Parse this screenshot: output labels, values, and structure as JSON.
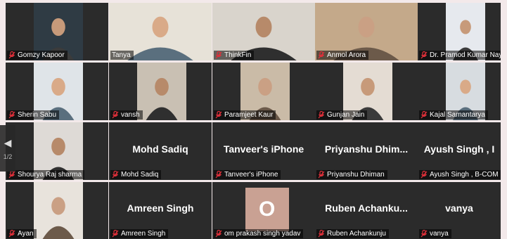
{
  "participants": [
    {
      "name": "Gomzy Kapoor",
      "muted": true,
      "video": true,
      "bg": "#2f3b44"
    },
    {
      "name": "Tanya",
      "muted": false,
      "video": true,
      "active": true,
      "bg": "#e7e2d8"
    },
    {
      "name": "ThinkFin",
      "muted": true,
      "video": true,
      "bg": "#d9d4cc"
    },
    {
      "name": "Anmol Arora",
      "muted": true,
      "video": true,
      "bg": "#c4a98a"
    },
    {
      "name": "Dr. Pramod Kumar Nayak",
      "muted": true,
      "video": true,
      "bg": "#e6e9ee"
    },
    {
      "name": "Sherin Sabu",
      "muted": true,
      "video": true,
      "bg": "#dfe4e8"
    },
    {
      "name": "vansh",
      "muted": true,
      "video": true,
      "bg": "#c9c0b3"
    },
    {
      "name": "Paramjeet Kaur",
      "muted": true,
      "video": true,
      "bg": "#cabba7"
    },
    {
      "name": "Gunjan Jain",
      "muted": true,
      "video": true,
      "bg": "#e4dcd3"
    },
    {
      "name": "Kajal Samantarya",
      "muted": true,
      "video": true,
      "bg": "#d7dce0"
    },
    {
      "name": "Shourya Raj sharma",
      "muted": true,
      "video": true,
      "bg": "#dedad6"
    },
    {
      "name": "Mohd Sadiq",
      "muted": true,
      "video": false,
      "display_name": "Mohd Sadiq"
    },
    {
      "name": "Tanveer's iPhone",
      "muted": true,
      "video": false,
      "display_name": "Tanveer's iPhone"
    },
    {
      "name": "Priyanshu Dhiman",
      "muted": true,
      "video": false,
      "display_name": "Priyanshu  Dhim..."
    },
    {
      "name": "Ayush Singh , B-COM",
      "muted": true,
      "video": false,
      "display_name": "Ayush Singh , I"
    },
    {
      "name": "Ayan",
      "muted": true,
      "video": true,
      "bg": "#e8e3dc"
    },
    {
      "name": "Amreen Singh",
      "muted": true,
      "video": false,
      "display_name": "Amreen Singh"
    },
    {
      "name": "om prakash singh yadav",
      "muted": true,
      "video": false,
      "avatar_letter": "O"
    },
    {
      "name": "Ruben Achankunju",
      "muted": true,
      "video": false,
      "display_name": "Ruben  Achanku..."
    },
    {
      "name": "vanya",
      "muted": true,
      "video": false,
      "display_name": "vanya"
    }
  ],
  "pager": {
    "prev_icon": "chevron-left-icon",
    "page": "1/2"
  },
  "colors": {
    "tile": "#2b2b2b",
    "muted_icon": "#e0303a",
    "active_outline": "#d8e86a"
  }
}
